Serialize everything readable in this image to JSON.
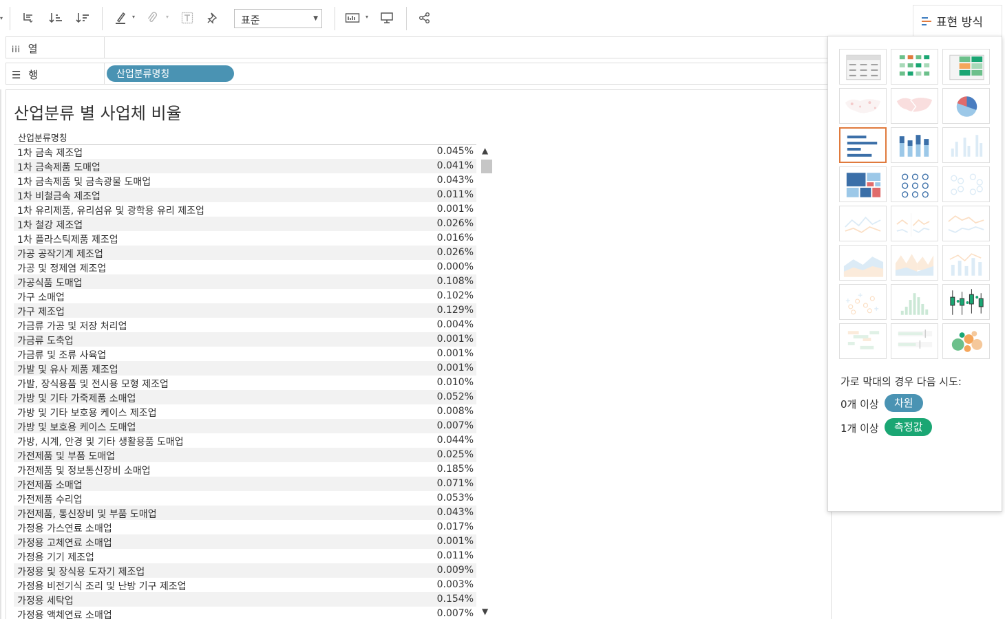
{
  "toolbar": {
    "standard_select": "표준",
    "icons": [
      "swap-rows-columns-icon",
      "sort-ascending-icon",
      "sort-descending-icon",
      "highlight-icon",
      "attach-icon",
      "label-icon",
      "pin-icon",
      "show-cards-icon",
      "presentation-icon",
      "share-icon"
    ]
  },
  "show_me": {
    "tab_label": "표현 방식",
    "hint": "가로 막대의 경우 다음 시도:",
    "requirements": [
      {
        "prefix": "0개 이상",
        "chip": "차원",
        "color": "#4a93b3"
      },
      {
        "prefix": "1개 이상",
        "chip": "측정값",
        "color": "#1aa673"
      }
    ],
    "charts": [
      "text-table",
      "heat-map",
      "highlight-table",
      "symbol-map",
      "filled-map",
      "pie",
      "horizontal-bars",
      "stacked-bars",
      "side-by-side-bars",
      "treemap",
      "circle-views",
      "side-by-side-circles",
      "lines-continuous",
      "lines-discrete",
      "dual-lines",
      "area-continuous",
      "area-discrete",
      "dual-combination",
      "scatter",
      "histogram",
      "box-and-whisker",
      "gantt",
      "bullet",
      "packed-bubbles"
    ]
  },
  "shelves": {
    "columns_label": "열",
    "rows_label": "행",
    "rows_pill": "산업분류명칭"
  },
  "sheet": {
    "title": "산업분류 별 사업체 비율",
    "column_header": "산업분류명칭",
    "rows": [
      {
        "name": "1차 금속 제조업",
        "value": "0.045%"
      },
      {
        "name": "1차 금속제품 도매업",
        "value": "0.041%"
      },
      {
        "name": "1차 금속제품 및 금속광물 도매업",
        "value": "0.043%"
      },
      {
        "name": "1차 비철금속 제조업",
        "value": "0.011%"
      },
      {
        "name": "1차 유리제품, 유리섬유 및 광학용 유리 제조업",
        "value": "0.001%"
      },
      {
        "name": "1차 철강 제조업",
        "value": "0.026%"
      },
      {
        "name": "1차 플라스틱제품 제조업",
        "value": "0.016%"
      },
      {
        "name": "가공 공작기계 제조업",
        "value": "0.026%"
      },
      {
        "name": "가공 및 정제염 제조업",
        "value": "0.000%"
      },
      {
        "name": "가공식품 도매업",
        "value": "0.108%"
      },
      {
        "name": "가구 소매업",
        "value": "0.102%"
      },
      {
        "name": "가구 제조업",
        "value": "0.129%"
      },
      {
        "name": "가금류 가공 및 저장 처리업",
        "value": "0.004%"
      },
      {
        "name": "가금류 도축업",
        "value": "0.001%"
      },
      {
        "name": "가금류 및 조류 사육업",
        "value": "0.001%"
      },
      {
        "name": "가발 및 유사 제품 제조업",
        "value": "0.001%"
      },
      {
        "name": "가발, 장식용품 및 전시용 모형 제조업",
        "value": "0.010%"
      },
      {
        "name": "가방 및 기타 가죽제품 소매업",
        "value": "0.052%"
      },
      {
        "name": "가방 및 기타 보호용 케이스 제조업",
        "value": "0.008%"
      },
      {
        "name": "가방 및 보호용 케이스 도매업",
        "value": "0.007%"
      },
      {
        "name": "가방, 시계, 안경 및 기타 생활용품 도매업",
        "value": "0.044%"
      },
      {
        "name": "가전제품 및 부품 도매업",
        "value": "0.025%"
      },
      {
        "name": "가전제품 및 정보통신장비 소매업",
        "value": "0.185%"
      },
      {
        "name": "가전제품 소매업",
        "value": "0.071%"
      },
      {
        "name": "가전제품 수리업",
        "value": "0.053%"
      },
      {
        "name": "가전제품, 통신장비 및 부품 도매업",
        "value": "0.043%"
      },
      {
        "name": "가정용 가스연료 소매업",
        "value": "0.017%"
      },
      {
        "name": "가정용 고체연료 소매업",
        "value": "0.001%"
      },
      {
        "name": "가정용 기기 제조업",
        "value": "0.011%"
      },
      {
        "name": "가정용 및 장식용 도자기 제조업",
        "value": "0.009%"
      },
      {
        "name": "가정용 비전기식 조리 및 난방 기구 제조업",
        "value": "0.003%"
      },
      {
        "name": "가정용 세탁업",
        "value": "0.154%"
      },
      {
        "name": "가정용 액체연료 소매업",
        "value": "0.007%"
      }
    ]
  }
}
